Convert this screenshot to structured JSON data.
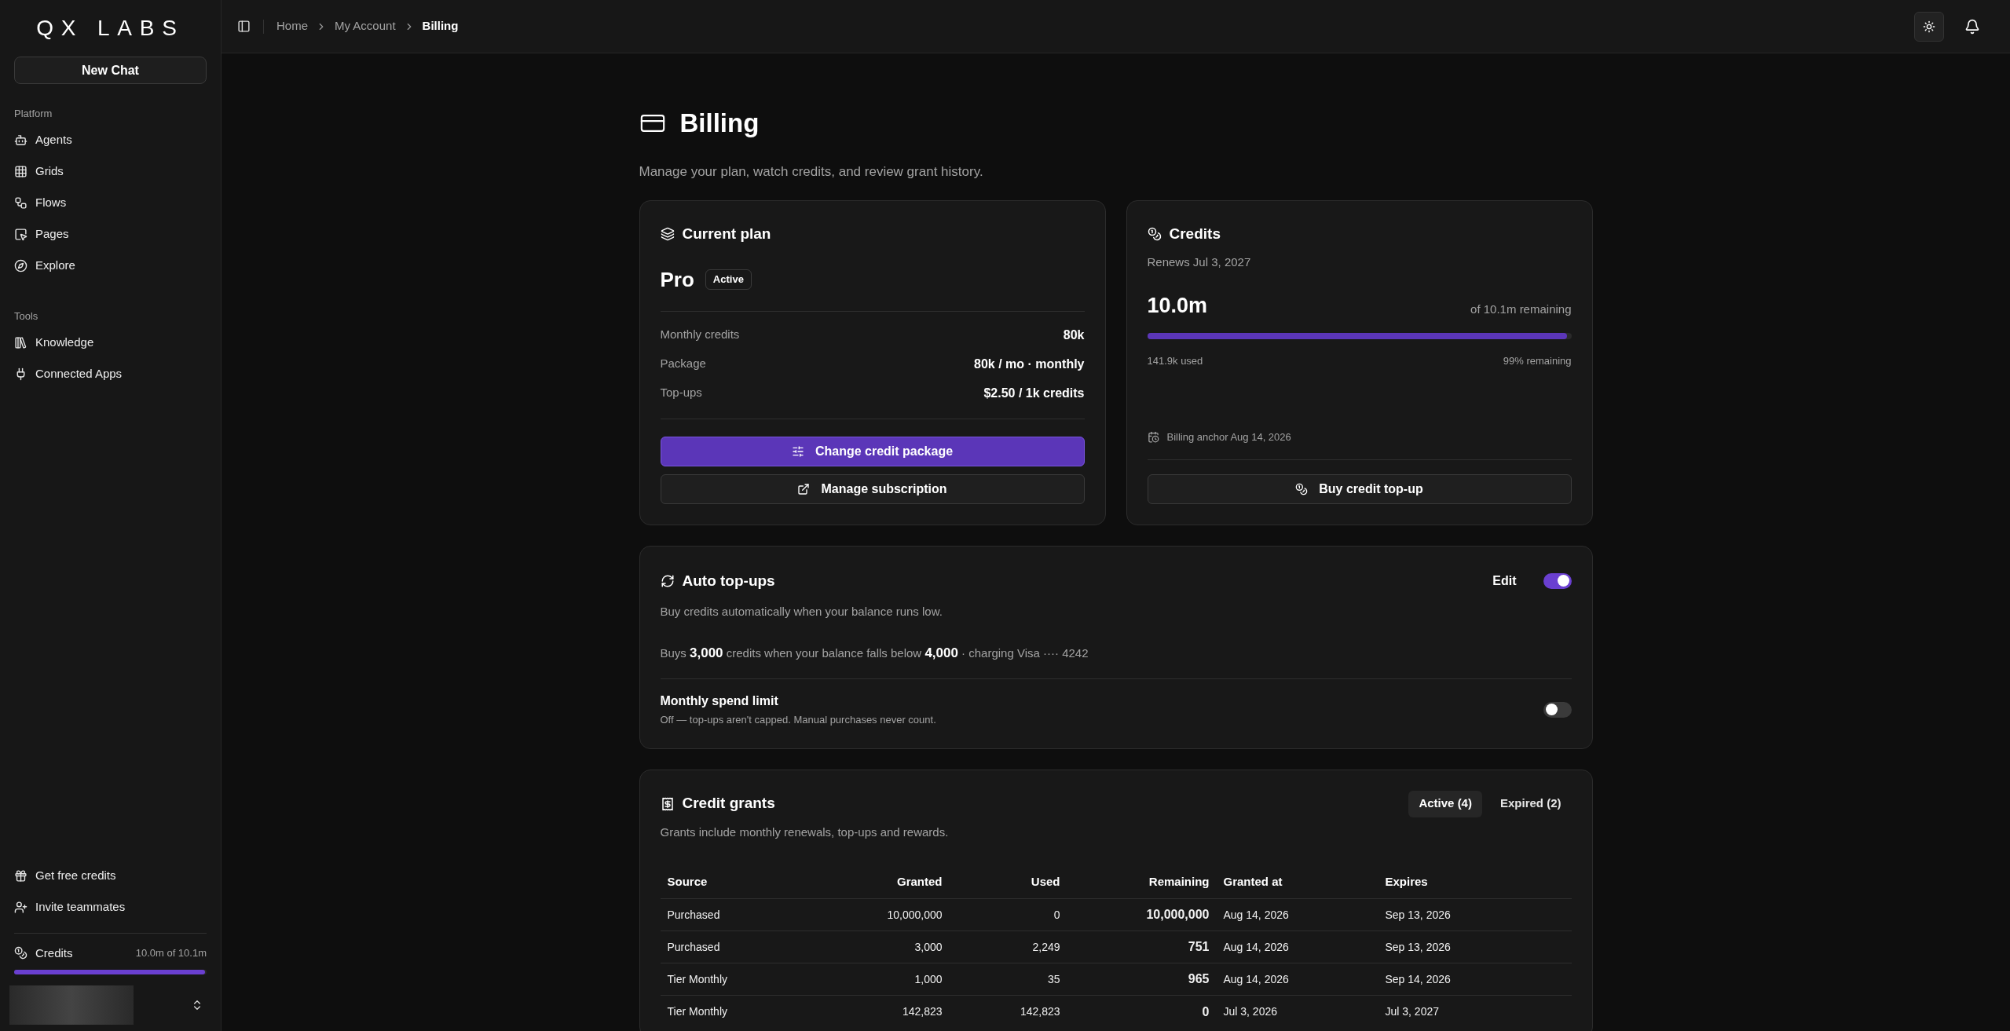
{
  "sidebar": {
    "logo": "QX LABS",
    "new_chat": "New Chat",
    "sections": [
      {
        "title": "Platform",
        "items": [
          {
            "label": "Agents"
          },
          {
            "label": "Grids"
          },
          {
            "label": "Flows"
          },
          {
            "label": "Pages"
          },
          {
            "label": "Explore"
          }
        ]
      },
      {
        "title": "Tools",
        "items": [
          {
            "label": "Knowledge"
          },
          {
            "label": "Connected Apps"
          }
        ]
      }
    ],
    "footer_items": [
      {
        "label": "Get free credits"
      },
      {
        "label": "Invite teammates"
      }
    ],
    "credits": {
      "label": "Credits",
      "reading": "10.0m of 10.1m",
      "level": 0.99
    }
  },
  "header": {
    "breadcrumbs": [
      "Home",
      "My Account",
      "Billing"
    ]
  },
  "page": {
    "title": "Billing",
    "subtitle": "Manage your plan, watch credits, and review grant history."
  },
  "plan": {
    "title": "Current plan",
    "name": "Pro",
    "badge": "Active",
    "rows": [
      {
        "label": "Monthly credits",
        "value": "80k"
      },
      {
        "label": "Package",
        "value": "80k / mo · monthly"
      },
      {
        "label": "Top-ups",
        "value": "$2.50 / 1k credits"
      }
    ],
    "primary_button": "Change credit package",
    "secondary_button": "Manage subscription"
  },
  "credits": {
    "title": "Credits",
    "renews": "Renews Jul 3, 2027",
    "amount": "10.0m",
    "of": "of 10.1m remaining",
    "level": 0.99,
    "used": "141.9k used",
    "remaining": "99% remaining",
    "anchor": "Billing anchor Aug 14, 2026",
    "button": "Buy credit top-up"
  },
  "auto_topups": {
    "title": "Auto top-ups",
    "edit": "Edit",
    "on": true,
    "description": "Buy credits automatically when your balance runs low.",
    "rule": "Buys **3,000** credits when your balance falls below **4,000** · charging Visa ···· 4242",
    "spend_limit": {
      "title": "Monthly spend limit",
      "description": "Off — top-ups aren't capped. Manual purchases never count.",
      "on": false
    }
  },
  "grants": {
    "title": "Credit grants",
    "description": "Grants include monthly renewals, top-ups and rewards.",
    "tabs": [
      {
        "label": "Active (4)",
        "selected": true
      },
      {
        "label": "Expired (2)",
        "selected": false
      }
    ],
    "columns": [
      "Source",
      "Granted",
      "Used",
      "Remaining",
      "Granted at",
      "Expires"
    ],
    "rows": [
      [
        "Purchased",
        "10,000,000",
        "0",
        "10,000,000",
        "Aug 14, 2026",
        "Sep 13, 2026"
      ],
      [
        "Purchased",
        "3,000",
        "2,249",
        "751",
        "Aug 14, 2026",
        "Sep 13, 2026"
      ],
      [
        "Tier Monthly",
        "1,000",
        "35",
        "965",
        "Aug 14, 2026",
        "Sep 14, 2026"
      ],
      [
        "Tier Monthly",
        "142,823",
        "142,823",
        "0",
        "Jul 3, 2026",
        "Jul 3, 2027"
      ]
    ]
  }
}
